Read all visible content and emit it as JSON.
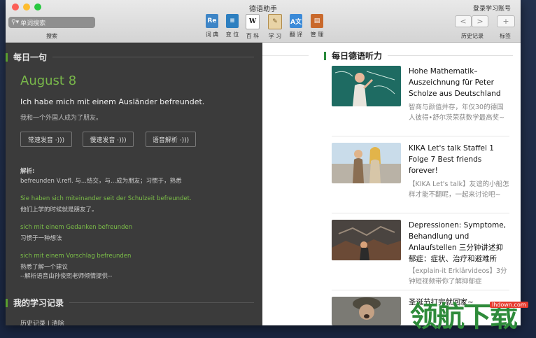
{
  "window": {
    "title": "德语助手",
    "login": "登录学习账号"
  },
  "search": {
    "placeholder": "单词搜索",
    "caption": "搜索"
  },
  "tools": [
    {
      "label": "词 典",
      "icon": "dictionary-icon",
      "color": "#3e85c6",
      "glyph": "Re"
    },
    {
      "label": "变 位",
      "icon": "conjugation-icon",
      "color": "#2d7fc0",
      "glyph": "≡"
    },
    {
      "label": "百 科",
      "icon": "wikipedia-icon",
      "color": "#ffffff",
      "glyph": "W"
    },
    {
      "label": "学 习",
      "icon": "study-icon",
      "color": "#c9a46a",
      "glyph": "✎"
    },
    {
      "label": "翻 译",
      "icon": "translate-icon",
      "color": "#3b8ad8",
      "glyph": "A"
    },
    {
      "label": "管 理",
      "icon": "manage-icon",
      "color": "#c9692c",
      "glyph": "▤"
    }
  ],
  "nav": {
    "back": "<",
    "forward": ">",
    "add": "+",
    "history_label": "历史记录",
    "tags_label": "标签"
  },
  "daily": {
    "section_title": "每日一句",
    "date": "August 8",
    "sentence": "Ich habe mich mit einem Ausländer befreundet.",
    "translation": "我和一个外国人成为了朋友。",
    "buttons": [
      "常速发音 ·)))",
      "慢速发音 ·)))",
      "语音解析 ·)))"
    ],
    "analysis_label": "解析:",
    "analysis_text": "befreunden V.refl. 与...结交，与...成为朋友；习惯于，熟悉",
    "ex1_de": "Sie haben sich miteinander seit der Schulzeit befreundet.",
    "ex1_cn": "他们上学的时候就是朋友了。",
    "ex2_de": "sich mit einem Gedanken befreunden",
    "ex2_cn": "习惯于一种想法",
    "ex3_de": "sich mit einem Vorschlag befreunden",
    "ex3_cn": "熟悉了解一个建议",
    "credit": "--解析语音由孙俊熙老师倾情提供--"
  },
  "records": {
    "section_title": "我的学习记录",
    "links": "历史记录 | 清除"
  },
  "listening": {
    "section_title": "每日德语听力",
    "items": [
      {
        "title": "Hohe Mathematik–Auszeichnung für Peter Scholze aus Deutschland",
        "desc": "智商与颜值并存，年仅30的德国人彼得•舒尔茨荣获数学最高奖~"
      },
      {
        "title": "KIKA Let's talk Staffel 1 Folge 7 Best friends forever!",
        "desc": "【KIKA Let's talk】友谊的小船怎样才能不翻呢，一起来讨论吧~"
      },
      {
        "title": "Depressionen: Symptome, Behandlung und Anlaufstellen 三分钟讲述抑郁症：症状、治疗和避难所",
        "desc": "【explain-it Erklärvideos】3分钟短视频带你了解抑郁症"
      },
      {
        "title": "圣诞节打完就回家~",
        "desc": ""
      }
    ]
  },
  "watermark": {
    "text": "领航下载",
    "site": "lhdown.com"
  }
}
